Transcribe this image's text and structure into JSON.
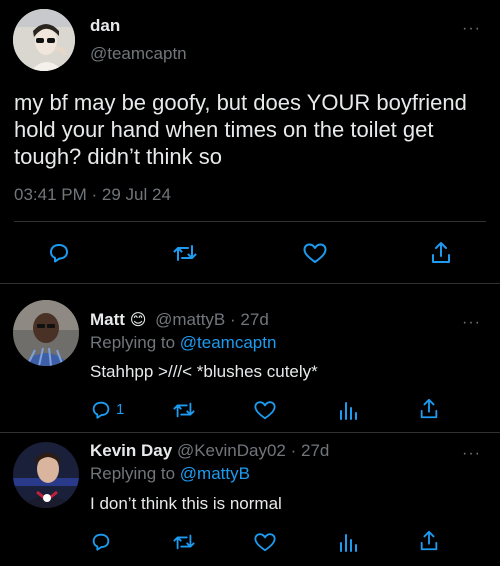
{
  "main_tweet": {
    "name": "dan",
    "handle": "@teamcaptn",
    "text": "my bf may be goofy, but does YOUR boyfriend hold your hand when times on the toilet get tough? didn’t think so",
    "time": "03:41 PM",
    "separator": "·",
    "date": "29 Jul 24",
    "more": "···",
    "actions": [
      "reply-icon",
      "retweet-icon",
      "like-icon",
      "share-icon"
    ]
  },
  "replies": [
    {
      "name": "Matt",
      "emoji": "😊",
      "handle": "@mattyB",
      "sep": "·",
      "age": "27d",
      "replying_prefix": "Replying to",
      "replying_to": "@teamcaptn",
      "text": "Stahhpp >///< *blushes cutely*",
      "reply_count": "1",
      "more": "···"
    },
    {
      "name": "Kevin Day",
      "handle": "@KevinDay02",
      "sep": "·",
      "age": "27d",
      "replying_prefix": "Replying to",
      "replying_to": "@mattyB",
      "text": "I don’t think this is normal",
      "more": "···"
    }
  ],
  "colors": {
    "background": "#000000",
    "text": "#e7e9ea",
    "muted": "#71767b",
    "accent": "#1d9bf0",
    "divider": "#2f3336"
  }
}
